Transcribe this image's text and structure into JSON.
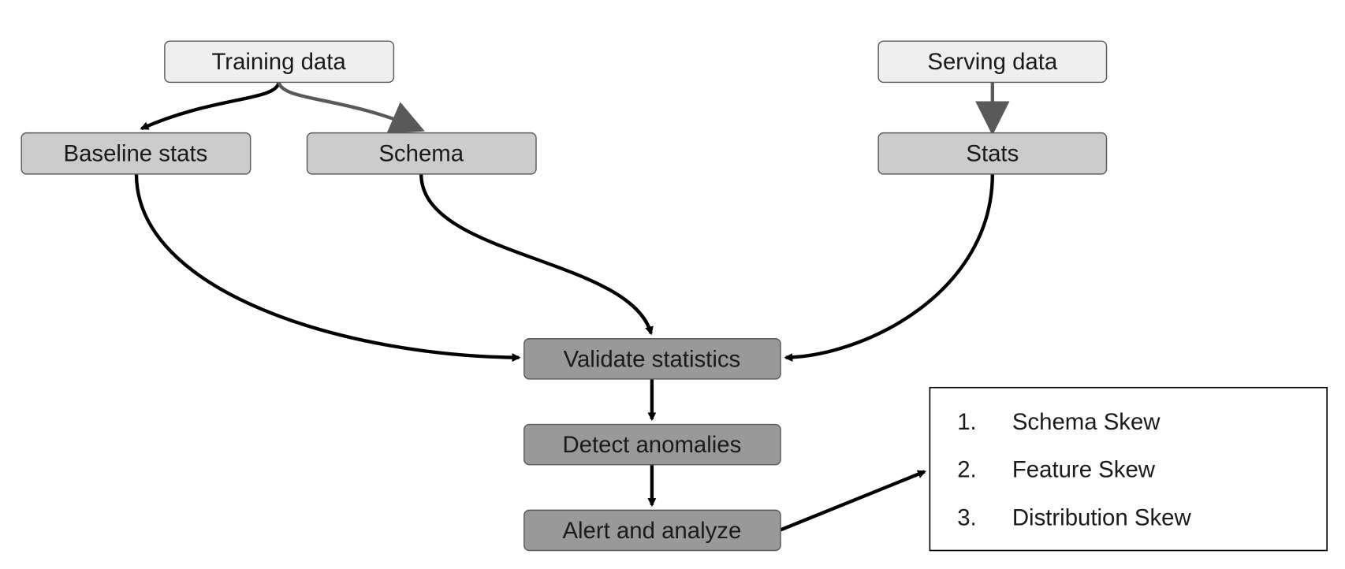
{
  "nodes": {
    "training_data": "Training data",
    "serving_data": "Serving data",
    "baseline_stats": "Baseline stats",
    "schema": "Schema",
    "stats": "Stats",
    "validate_statistics": "Validate statistics",
    "detect_anomalies": "Detect anomalies",
    "alert_and_analyze": "Alert and analyze"
  },
  "skew_list": [
    {
      "number": "1.",
      "label": "Schema Skew"
    },
    {
      "number": "2.",
      "label": "Feature Skew"
    },
    {
      "number": "3.",
      "label": "Distribution Skew"
    }
  ],
  "colors": {
    "source_fill": "#efefef",
    "artifact_fill": "#cccccc",
    "process_fill": "#999999",
    "border": "#595959",
    "arrow_black": "#000000",
    "arrow_gray": "#595959"
  }
}
